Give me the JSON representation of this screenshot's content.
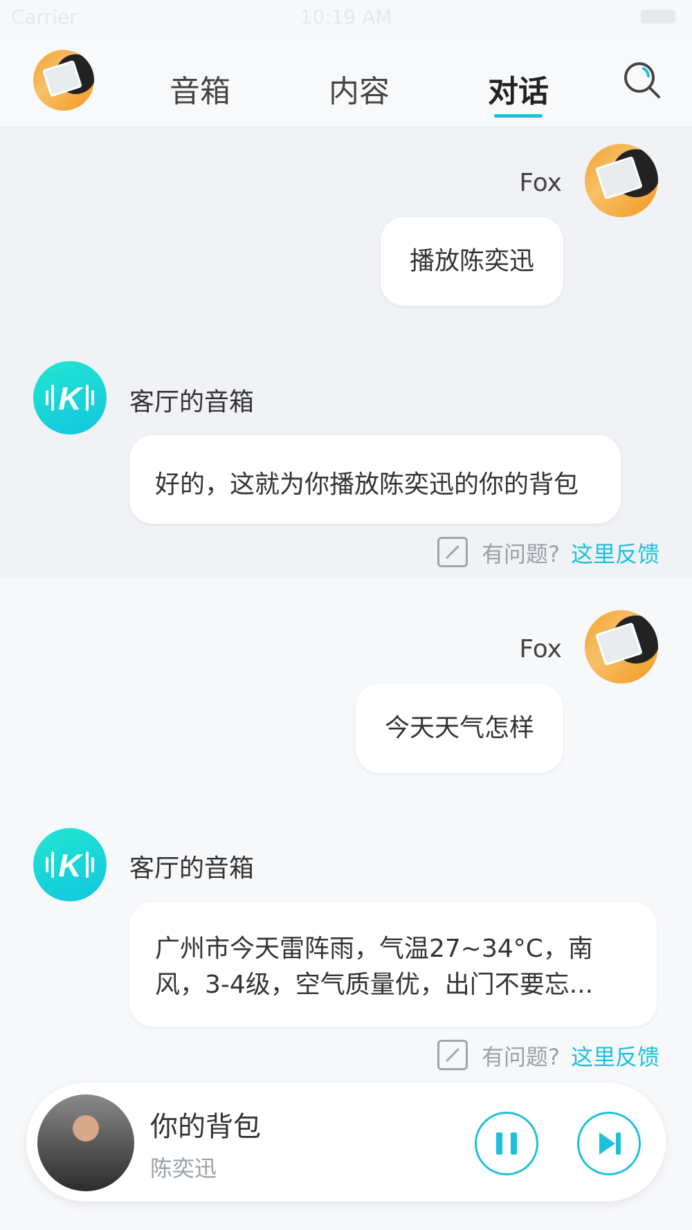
{
  "status_bar": {
    "carrier": "Carrier",
    "time": "10:19 AM"
  },
  "header": {
    "tabs": [
      {
        "label": "音箱",
        "active": false
      },
      {
        "label": "内容",
        "active": false
      },
      {
        "label": "对话",
        "active": true
      }
    ],
    "accent_color": "#1cc0dc"
  },
  "conversations": [
    {
      "user_name": "Fox",
      "user_message": "播放陈奕迅",
      "bot_name": "客厅的音箱",
      "bot_reply": "好的，这就为你播放陈奕迅的你的背包",
      "feedback_question": "有问题?",
      "feedback_link": "这里反馈"
    },
    {
      "user_name": "Fox",
      "user_message": "今天天气怎样",
      "bot_name": "客厅的音箱",
      "bot_reply_line1": "广州市今天雷阵雨，气温27~34°C，南",
      "bot_reply_line2": "风，3-4级，空气质量优，出门不要忘...",
      "feedback_question": "有问题?",
      "feedback_link": "这里反馈"
    }
  ],
  "player": {
    "song": "你的背包",
    "artist": "陈奕迅",
    "pause_icon": "pause-icon",
    "next_icon": "next-track-icon"
  }
}
